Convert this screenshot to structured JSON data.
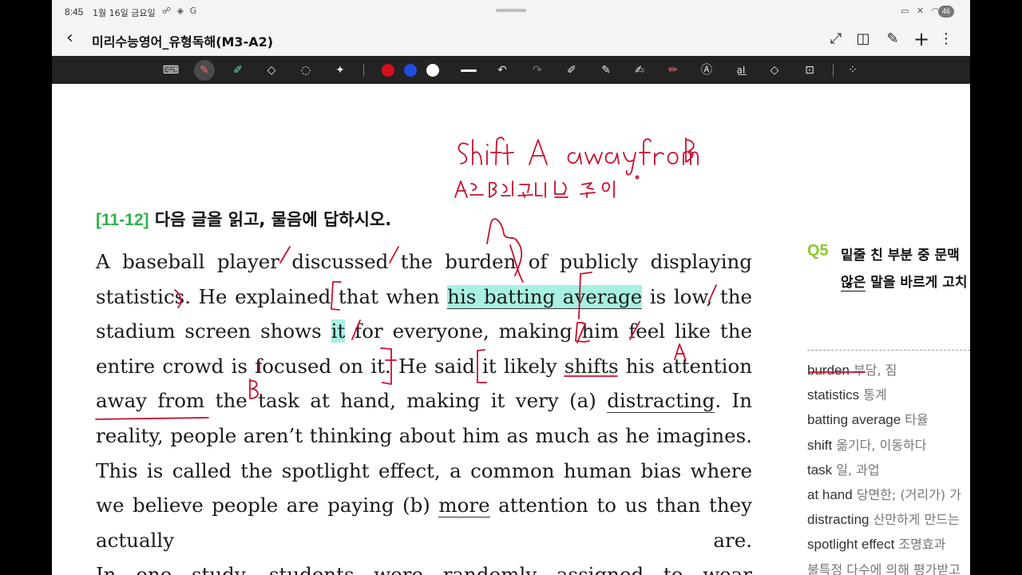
{
  "status_bar": {
    "time": "8:45",
    "date": "1월 16일 금요일",
    "notification_icons": "☍ ◈ G",
    "system_icons": "▭ ✕ ◠",
    "battery": "46"
  },
  "title_bar": {
    "back_glyph": "‹",
    "title": "미리수능영어_유형독해(M3-A2)",
    "actions": [
      {
        "name": "expand",
        "glyph": "⤢"
      },
      {
        "name": "reading-mode",
        "glyph": "◫"
      },
      {
        "name": "edit-page",
        "glyph": "✎"
      },
      {
        "name": "add",
        "glyph": "+"
      },
      {
        "name": "more",
        "glyph": "⋮"
      }
    ]
  },
  "toolbar": {
    "tools": [
      {
        "name": "keyboard",
        "glyph": "⌨"
      },
      {
        "name": "pen",
        "glyph": "✎"
      },
      {
        "name": "highlighter",
        "glyph": "✐"
      },
      {
        "name": "eraser",
        "glyph": "◇"
      },
      {
        "name": "lasso",
        "glyph": "◌"
      },
      {
        "name": "magic",
        "glyph": "✦"
      }
    ],
    "colors": [
      "#d4101c",
      "#1f4fe0",
      "#ffffff"
    ],
    "right_tools": [
      {
        "name": "undo",
        "glyph": "↶"
      },
      {
        "name": "redo",
        "glyph": "↷"
      },
      {
        "name": "pen-settings-1",
        "glyph": "✐"
      },
      {
        "name": "pen-settings-2",
        "glyph": "✎"
      },
      {
        "name": "pen-settings-3",
        "glyph": "✍"
      },
      {
        "name": "red-pen",
        "glyph": "✏"
      },
      {
        "name": "text-style",
        "glyph": "Ⓐ"
      },
      {
        "name": "text-box",
        "glyph": "a͟I"
      },
      {
        "name": "shapes",
        "glyph": "◇"
      },
      {
        "name": "page-lock",
        "glyph": "⊡"
      },
      {
        "name": "grid",
        "glyph": "⁘"
      }
    ]
  },
  "question": {
    "number": "[11-12]",
    "instruction": "다음 글을 읽고, 물음에 답하시오."
  },
  "passage": {
    "lines": [
      [
        {
          "t": "A baseball player discussed the burden of publicly displaying"
        }
      ],
      [
        {
          "t": "statistics. He explained that when "
        },
        {
          "t": "his batting average",
          "s": "hl-ul"
        },
        {
          "t": " is low, the"
        }
      ],
      [
        {
          "t": "stadium screen shows "
        },
        {
          "t": "it",
          "s": "hl"
        },
        {
          "t": " for everyone, making him feel like the"
        }
      ],
      [
        {
          "t": "entire crowd is focused on it. He said it likely shifts his attention"
        }
      ],
      [
        {
          "t": "away from the task at hand, making it very (a) "
        },
        {
          "t": "distracting",
          "s": "ul"
        },
        {
          "t": ". In"
        }
      ],
      [
        {
          "t": "reality, people aren’t thinking about him as much as he imagines."
        }
      ],
      [
        {
          "t": "This is called the spotlight effect, a common human bias where"
        }
      ],
      [
        {
          "t": "we believe people are paying (b) "
        },
        {
          "t": "more",
          "s": "ul"
        },
        {
          "t": " attention to us than they"
        }
      ],
      [
        {
          "t": "actually are."
        }
      ],
      [
        {
          "t": "In one study, students were randomly assigned to wear"
        }
      ]
    ]
  },
  "q5": {
    "label": "Q5",
    "line1": "밑줄 친 부분 중 문맥",
    "line2_underlined": "않은",
    "line2_rest": " 말을 바르게 고치"
  },
  "vocab": [
    {
      "en": "burden",
      "ko": " 부담, 짐",
      "marked": true
    },
    {
      "en": "statistics",
      "ko": " 통계",
      "marked": false
    },
    {
      "en": "batting average",
      "ko": " 타율",
      "marked": false
    },
    {
      "en": "shift",
      "ko": " 옮기다, 이동하다",
      "marked": false
    },
    {
      "en": "task",
      "ko": " 일, 과업",
      "marked": false
    },
    {
      "en": "at hand",
      "ko": " 당면한; (거리가) 가",
      "marked": false
    },
    {
      "en": "distracting",
      "ko": " 산만하게 만드는",
      "marked": false
    },
    {
      "en": "spotlight effect",
      "ko": " 조명효과",
      "marked": false
    },
    {
      "en": "",
      "ko": "불특정 다수에 의해 평가받고",
      "marked": false
    }
  ],
  "ink_color": "#c8102e"
}
